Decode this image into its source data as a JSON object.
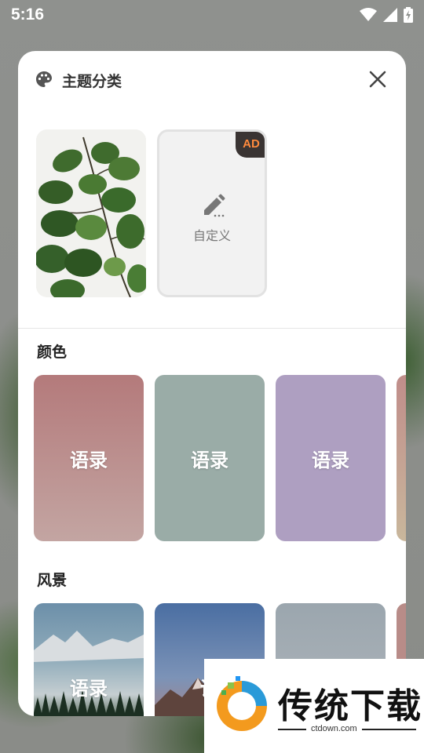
{
  "status_bar": {
    "time": "5:16"
  },
  "sheet": {
    "title": "主题分类",
    "custom_label": "自定义",
    "ad_badge": "AD"
  },
  "sections": {
    "color": {
      "title": "颜色",
      "cards": [
        {
          "label": "语录",
          "color": "#b88c8a"
        },
        {
          "label": "语录",
          "color": "#9aaca7"
        },
        {
          "label": "语录",
          "color": "#ae9fc1"
        },
        {
          "label": "",
          "color": "#c3a493"
        }
      ]
    },
    "scenery": {
      "title": "风景",
      "cards": [
        {
          "label": "语录"
        },
        {
          "label": "语"
        },
        {
          "label": ""
        },
        {
          "label": ""
        }
      ]
    }
  },
  "watermark": {
    "title": "传统下载",
    "url": "ctdown.com"
  }
}
